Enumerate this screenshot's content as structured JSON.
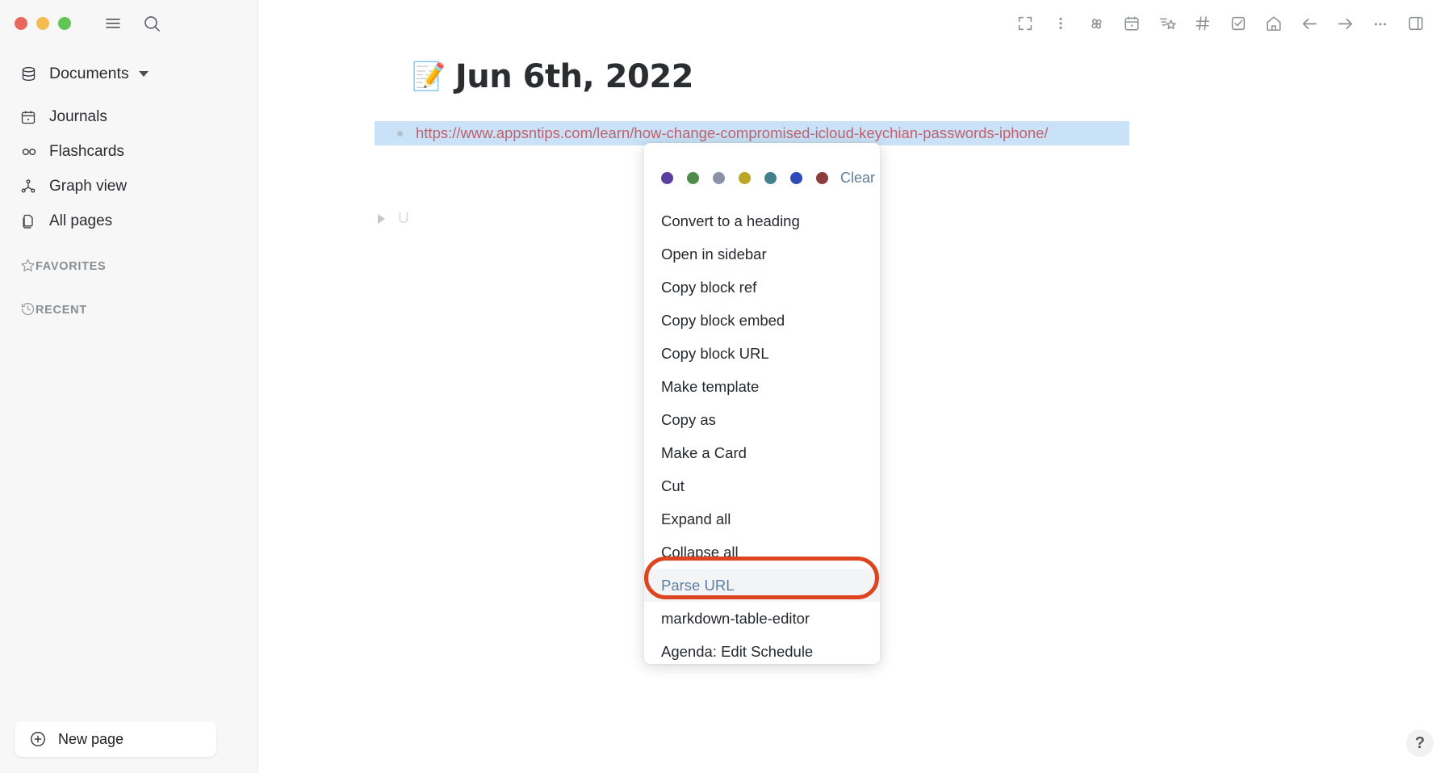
{
  "window": {
    "traffic_lights": [
      "close",
      "minimize",
      "zoom"
    ],
    "colors": {
      "red": "#e9685e",
      "yellow": "#f4bd4f",
      "green": "#61c454"
    }
  },
  "sidebar": {
    "hamburger_icon": "hamburger-icon",
    "search_icon": "search-icon",
    "graph_label": "Documents",
    "items": [
      {
        "label": "Journals",
        "icon": "calendar-icon"
      },
      {
        "label": "Flashcards",
        "icon": "infinity-icon"
      },
      {
        "label": "Graph view",
        "icon": "graph-icon"
      },
      {
        "label": "All pages",
        "icon": "pages-icon"
      }
    ],
    "sections": [
      {
        "label": "FAVORITES",
        "icon": "star-icon"
      },
      {
        "label": "RECENT",
        "icon": "clock-history-icon"
      }
    ],
    "new_page_label": "New page"
  },
  "toolbar": {
    "icons": [
      "fullscreen-icon",
      "vertical-dots-icon",
      "pinwheel-icon",
      "calendar-icon",
      "shooting-star-icon",
      "hash-icon",
      "checkbox-icon",
      "home-icon",
      "back-arrow-icon",
      "forward-arrow-icon",
      "horizontal-dots-icon",
      "right-sidebar-toggle-icon"
    ]
  },
  "document": {
    "title_emoji": "📝",
    "title": "Jun 6th, 2022",
    "blocks": [
      {
        "text": "https://www.appsntips.com/learn/how-change-compromised-icloud-keychian-passwords-iphone/",
        "selected": true
      },
      {
        "text": "U",
        "collapsed": true
      }
    ]
  },
  "context_menu": {
    "swatches": [
      {
        "name": "purple",
        "color": "#5b3f9e"
      },
      {
        "name": "green",
        "color": "#4f8b4c"
      },
      {
        "name": "gray-blue",
        "color": "#8992a8"
      },
      {
        "name": "yellow",
        "color": "#bba524"
      },
      {
        "name": "teal",
        "color": "#42808e"
      },
      {
        "name": "blue",
        "color": "#2f4ab9"
      },
      {
        "name": "dark-red",
        "color": "#8d3d3d"
      }
    ],
    "clear_label": "Clear",
    "items": [
      {
        "label": "Convert to a heading"
      },
      {
        "label": "Open in sidebar"
      },
      {
        "label": "Copy block ref"
      },
      {
        "label": "Copy block embed"
      },
      {
        "label": "Copy block URL"
      },
      {
        "label": "Make template"
      },
      {
        "label": "Copy as"
      },
      {
        "label": "Make a Card"
      },
      {
        "label": "Cut"
      },
      {
        "label": "Expand all"
      },
      {
        "label": "Collapse all"
      },
      {
        "label": "Parse URL",
        "accent": true,
        "hovered": true,
        "annotated": true
      },
      {
        "label": "markdown-table-editor"
      },
      {
        "label": "Agenda: Edit Schedule"
      }
    ],
    "annotation_color": "#dc4520"
  },
  "help": {
    "label": "?"
  }
}
